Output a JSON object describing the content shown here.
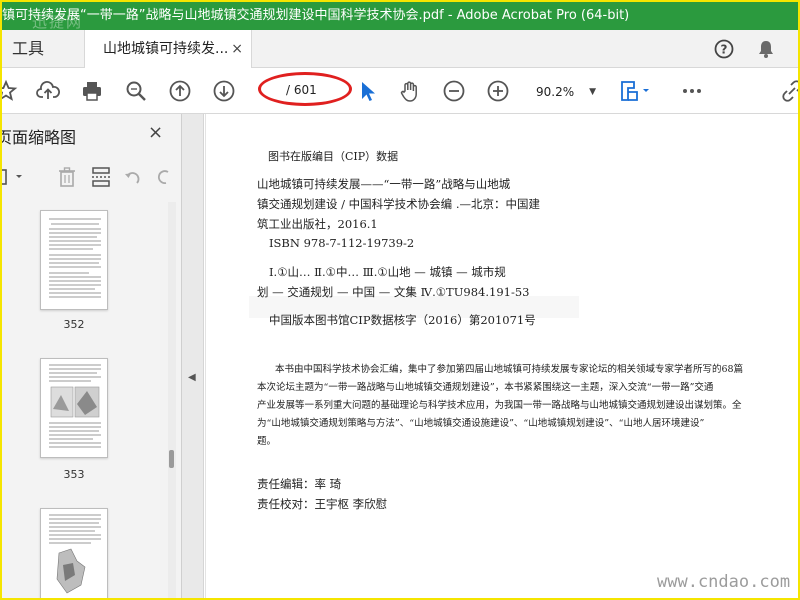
{
  "window": {
    "title": "镇可持续发展“一带一路”战略与山地城镇交通规划建设中国科学技术协会.pdf - Adobe Acrobat Pro (64-bit)",
    "watermark": "迅捷网"
  },
  "tabs": {
    "tools_label": "工具",
    "doc_label": "山地城镇可持续发...",
    "close_symbol": "×"
  },
  "toolbar": {
    "page_current": "",
    "page_total": "/ 601",
    "zoom": "90.2%"
  },
  "left_panel": {
    "title": "页面缩略图",
    "close_symbol": "×",
    "thumbnails": [
      {
        "label": "352"
      },
      {
        "label": "353"
      },
      {
        "label": ""
      }
    ]
  },
  "document": {
    "cip_title": "图书在版编目（CIP）数据",
    "cip_lines": [
      "山地城镇可持续发展——“一带一路”战略与山地城",
      "镇交通规划建设 / 中国科学技术协会编 .—北京：中国建",
      "筑工业出版社，2016.1",
      "ISBN 978-7-112-19739-2"
    ],
    "class_lines": [
      "Ⅰ.①山…  Ⅱ.①中…  Ⅲ.①山地 — 城镇 — 城市规",
      "划 — 交通规划 — 中国 — 文集  Ⅳ.①TU984.191-53"
    ],
    "cip_record": "中国版本图书馆CIP数据核字（2016）第201071号",
    "abstract_lines": [
      "本书由中国科学技术协会汇编，集中了参加第四届山地城镇可持续发展专家论坛的相关领域专家学者所写的68篇",
      "本次论坛主题为“一带一路战略与山地城镇交通规划建设”，本书紧紧围绕这一主题，深入交流“一带一路”交通",
      "产业发展等一系列重大问题的基础理论与科学技术应用，为我国一带一路战略与山地城镇交通规划建设出谋划策。全",
      "为“山地城镇交通规划策略与方法”、“山地城镇交通设施建设”、“山地城镇规划建设”、“山地人居环境建设”",
      "题。"
    ],
    "editor_line": "责任编辑：率  琦",
    "proof_line": "责任校对：王宇枢  李欣慰",
    "bottom_watermark": "www.cndao.com"
  },
  "colors": {
    "title_bar": "#2b9a3e",
    "outer_border": "#f5e500",
    "annotation_circle": "#e0201f",
    "select_tool": "#1a6fd6",
    "thumb_page_bg": "#ffffff"
  },
  "icons": [
    "star-icon",
    "upload-icon",
    "print-icon",
    "zoom-search-icon",
    "page-up-icon",
    "page-down-icon",
    "select-arrow-icon",
    "hand-icon",
    "zoom-out-icon",
    "zoom-in-icon",
    "fit-page-icon",
    "more-icon",
    "link-icon",
    "help-icon",
    "bell-icon",
    "view-options-icon",
    "trash-icon",
    "insert-page-icon",
    "undo-icon",
    "redo-icon"
  ]
}
